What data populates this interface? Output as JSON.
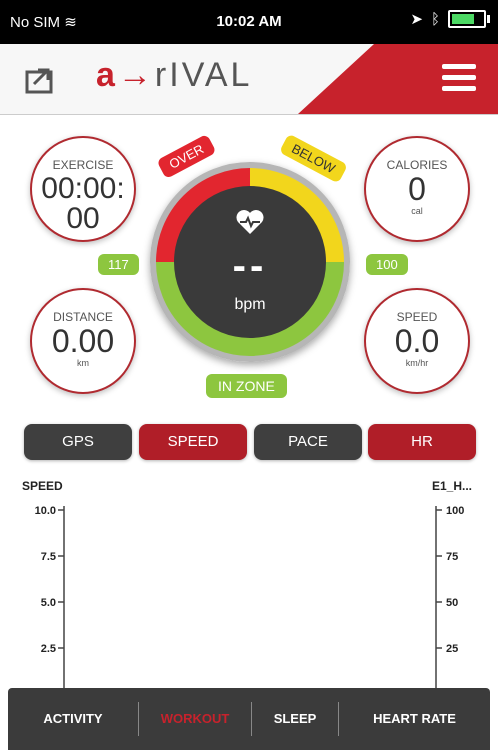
{
  "status_bar": {
    "carrier": "No SIM",
    "time": "10:02 AM"
  },
  "header": {
    "logo_accent": "a→",
    "logo_rest": "rIVAL"
  },
  "stats": {
    "exercise": {
      "label": "EXERCISE",
      "value": "00:00:\n00"
    },
    "calories": {
      "label": "CALORIES",
      "value": "0",
      "unit": "cal"
    },
    "distance": {
      "label": "DISTANCE",
      "value": "0.00",
      "unit": "km"
    },
    "speed": {
      "label": "SPEED",
      "value": "0.0",
      "unit": "km/hr"
    }
  },
  "heart_rate": {
    "value": "--",
    "unit": "bpm",
    "over_label": "OVER",
    "below_label": "BELOW",
    "zone_label": "IN ZONE",
    "zone_low": "117",
    "zone_high": "100"
  },
  "tabs": [
    "GPS",
    "SPEED",
    "PACE",
    "HR"
  ],
  "chart_data": {
    "type": "line",
    "left_axis_label": "SPEED",
    "right_axis_label": "E1_H...",
    "left_ticks": [
      "10.0",
      "7.5",
      "5.0",
      "2.5"
    ],
    "right_ticks": [
      "100",
      "75",
      "50",
      "25"
    ],
    "series": []
  },
  "bottom_nav": [
    "ACTIVITY",
    "WORKOUT",
    "SLEEP",
    "HEART RATE"
  ],
  "colors": {
    "accent": "#c7222c",
    "zone_green": "#8dc63f",
    "zone_yellow": "#f2d61c",
    "zone_red": "#e2262f"
  }
}
